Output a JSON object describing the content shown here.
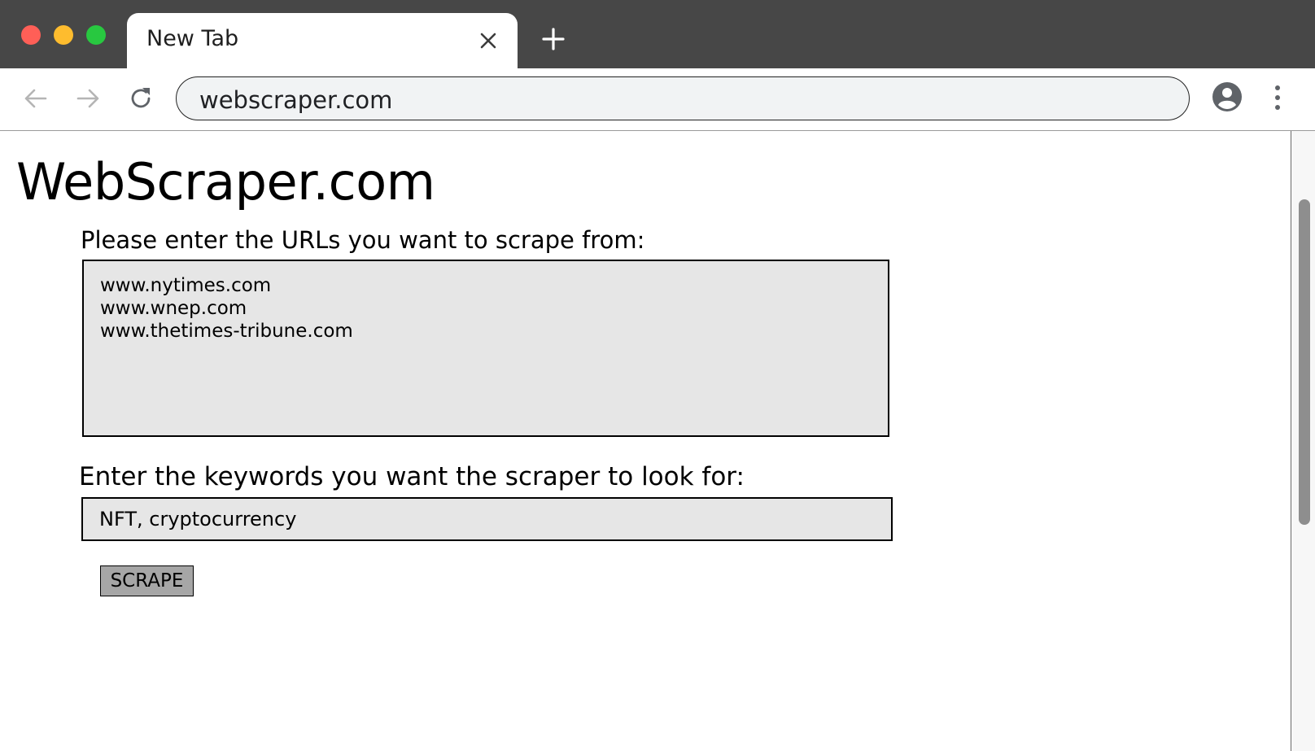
{
  "browser": {
    "tab_title": "New Tab",
    "address": "webscraper.com"
  },
  "icons": {
    "window_controls": [
      "close-dot",
      "minimize-dot",
      "zoom-dot"
    ],
    "tab_close": "close-icon",
    "new_tab": "plus-icon",
    "back": "arrow-left-icon",
    "forward": "arrow-right-icon",
    "reload": "reload-icon",
    "profile": "account-icon",
    "menu": "kebab-menu-icon"
  },
  "colors": {
    "titlebar": "#474747",
    "close_dot": "#ff5f57",
    "minimize_dot": "#febc2e",
    "zoom_dot": "#28c840",
    "field_bg": "#e6e6e6",
    "button_bg": "#a6a6a6"
  },
  "page": {
    "site_title": "WebScraper.com",
    "urls_label": "Please enter the URLs you want to scrape from:",
    "urls_value": "www.nytimes.com\nwww.wnep.com\nwww.thetimes-tribune.com",
    "keywords_label": "Enter the keywords you want the scraper to look for:",
    "keywords_value": "NFT, cryptocurrency",
    "scrape_label": "SCRAPE"
  }
}
